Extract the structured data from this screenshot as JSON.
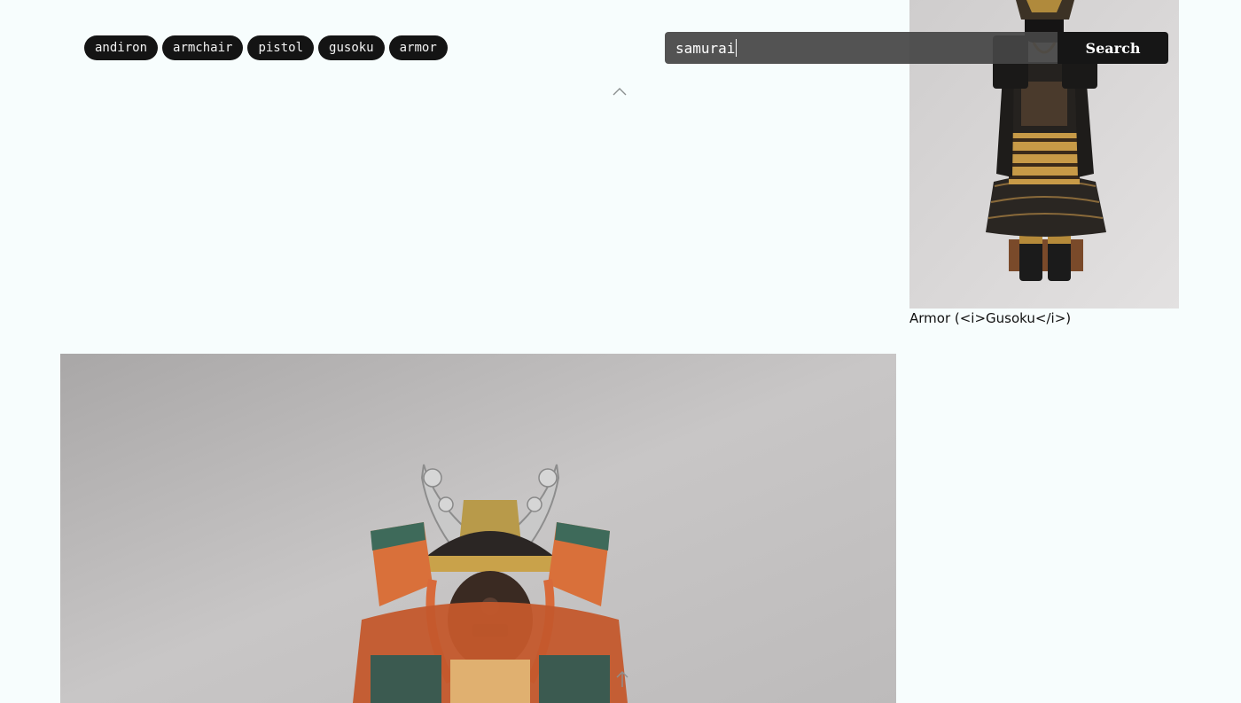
{
  "tags": [
    {
      "label": "andiron"
    },
    {
      "label": "armchair"
    },
    {
      "label": "pistol"
    },
    {
      "label": "gusoku"
    },
    {
      "label": "armor"
    }
  ],
  "search": {
    "query": "samurai",
    "button_label": "Search"
  },
  "results": [
    {
      "caption": "Armor (<i>Gusoku</i>)"
    }
  ],
  "icons": {
    "scroll_up": "chevron-up-icon",
    "back_to_top": "arrow-up-icon"
  },
  "colors": {
    "background": "#f7fdfd",
    "chip": "#141414",
    "search_field": "#464646",
    "search_button": "#161616"
  }
}
